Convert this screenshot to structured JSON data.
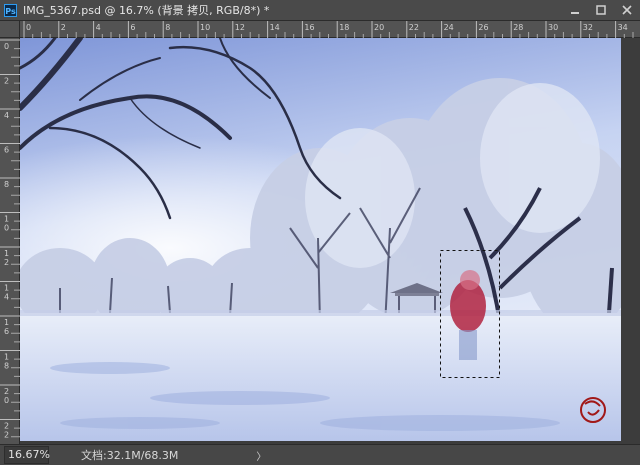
{
  "app": {
    "icon_label": "Ps"
  },
  "document": {
    "title": "IMG_5367.psd @ 16.7% (背景 拷贝, RGB/8*) *"
  },
  "ruler": {
    "horizontal_labels": [
      "0",
      "2",
      "4",
      "6",
      "8",
      "10",
      "12",
      "14",
      "16",
      "18",
      "20",
      "22",
      "24",
      "26",
      "28",
      "30",
      "32",
      "34"
    ],
    "vertical_labels": [
      "0",
      "2",
      "4",
      "6",
      "8",
      "10",
      "12",
      "14",
      "16",
      "18",
      "20",
      "22"
    ]
  },
  "status": {
    "zoom": "16.67%",
    "doc_info": "文档:32.1M/68.3M",
    "arrow": "〉"
  },
  "colors": {
    "chrome": "#3c3c3c",
    "ruler": "#535353",
    "accent": "#2d9bf0",
    "coat": "#b01f3c"
  }
}
